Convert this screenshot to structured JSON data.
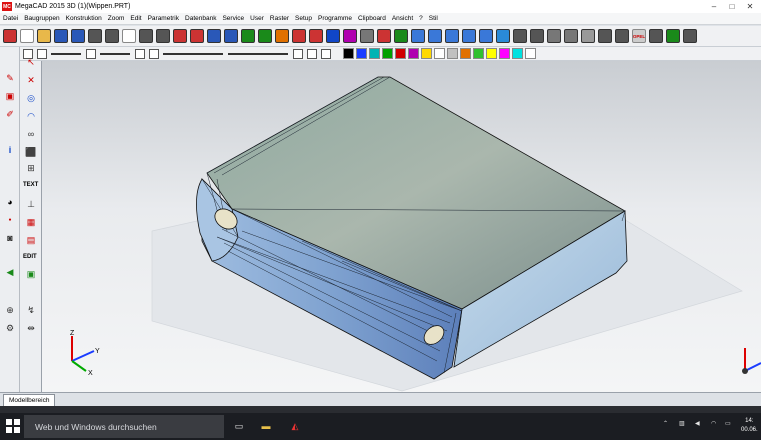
{
  "window": {
    "title": "MegaCAD 2015 3D (1)(Wippen.PRT)",
    "logo_text": "MC"
  },
  "menu": [
    "Datei",
    "Baugruppen",
    "Konstruktion",
    "Zoom",
    "Edit",
    "Parametrik",
    "Datenbank",
    "Service",
    "User",
    "Raster",
    "Setup",
    "Programme",
    "Clipboard",
    "Ansicht",
    "?",
    "Stil"
  ],
  "toolbar": {
    "icons": [
      "drawing-icon",
      "new-file-icon",
      "open-folder-icon",
      "save-icon",
      "save-as-icon",
      "print-icon",
      "print-preview-icon",
      "document-icon",
      "copy-icon",
      "paste-icon",
      "pen-icon",
      "eraser-icon",
      "undo-icon",
      "redo-icon",
      "zoom-window-icon",
      "zoom-all-icon",
      "layer-icon",
      "measure-icon",
      "snap-icon",
      "select-icon",
      "attribute-icon",
      "properties-icon",
      "macro-icon",
      "render-icon",
      "view-front-icon",
      "view-iso-icon",
      "view-top-icon",
      "view-side-icon",
      "view-back-icon",
      "shade-icon",
      "wireframe-icon",
      "hidden-line-icon",
      "cylinder-icon",
      "solid-icon",
      "part-icon",
      "assembly-icon",
      "toolbox-icon",
      "opel-icon",
      "grid-icon",
      "check-icon",
      "settings-icon"
    ],
    "opel_label": "OPEL"
  },
  "swatches": [
    "#000000",
    "#1a3cff",
    "#00b4b4",
    "#00a000",
    "#d00000",
    "#b000b0",
    "#ffd800",
    "#ffffff",
    "#c0c0c0",
    "#e07000",
    "#30c030",
    "#ffff00",
    "#ff00ff",
    "#00e0e0",
    "#ffffff"
  ],
  "left_tools": {
    "text_label": "TEXT",
    "edit_label": "EDIT",
    "info_label": "i"
  },
  "viewport": {
    "triad_labels": {
      "z": "Z",
      "y": "Y",
      "x": "X"
    }
  },
  "tabs": {
    "active": "Modellbereich"
  },
  "taskbar": {
    "search_placeholder": "Web und Windows durchsuchen",
    "time": "14:",
    "date": "00.06."
  }
}
